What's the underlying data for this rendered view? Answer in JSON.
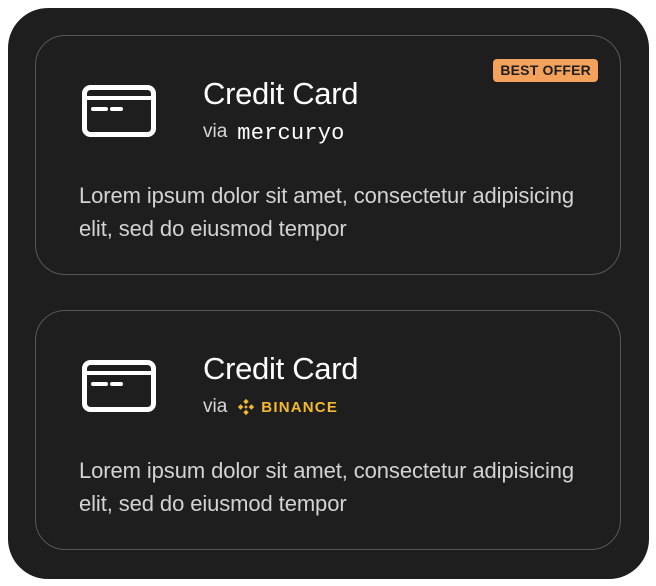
{
  "colors": {
    "panel_background": "#1e1e1e",
    "card_border": "#575757",
    "badge_background": "#f4a15c",
    "binance_yellow": "#f3ba2f"
  },
  "options": [
    {
      "icon": "credit-card-icon",
      "title": "Credit Card",
      "via_label": "via",
      "provider": "mercuryo",
      "description": "Lorem ipsum dolor sit amet, consectetur adipisicing elit, sed do eiusmod tempor",
      "badge": "BEST OFFER"
    },
    {
      "icon": "credit-card-icon",
      "title": "Credit Card",
      "via_label": "via",
      "provider": "BINANCE",
      "provider_logo": "binance-logo-icon",
      "description": "Lorem ipsum dolor sit amet, consectetur adipisicing elit, sed do eiusmod tempor"
    }
  ]
}
